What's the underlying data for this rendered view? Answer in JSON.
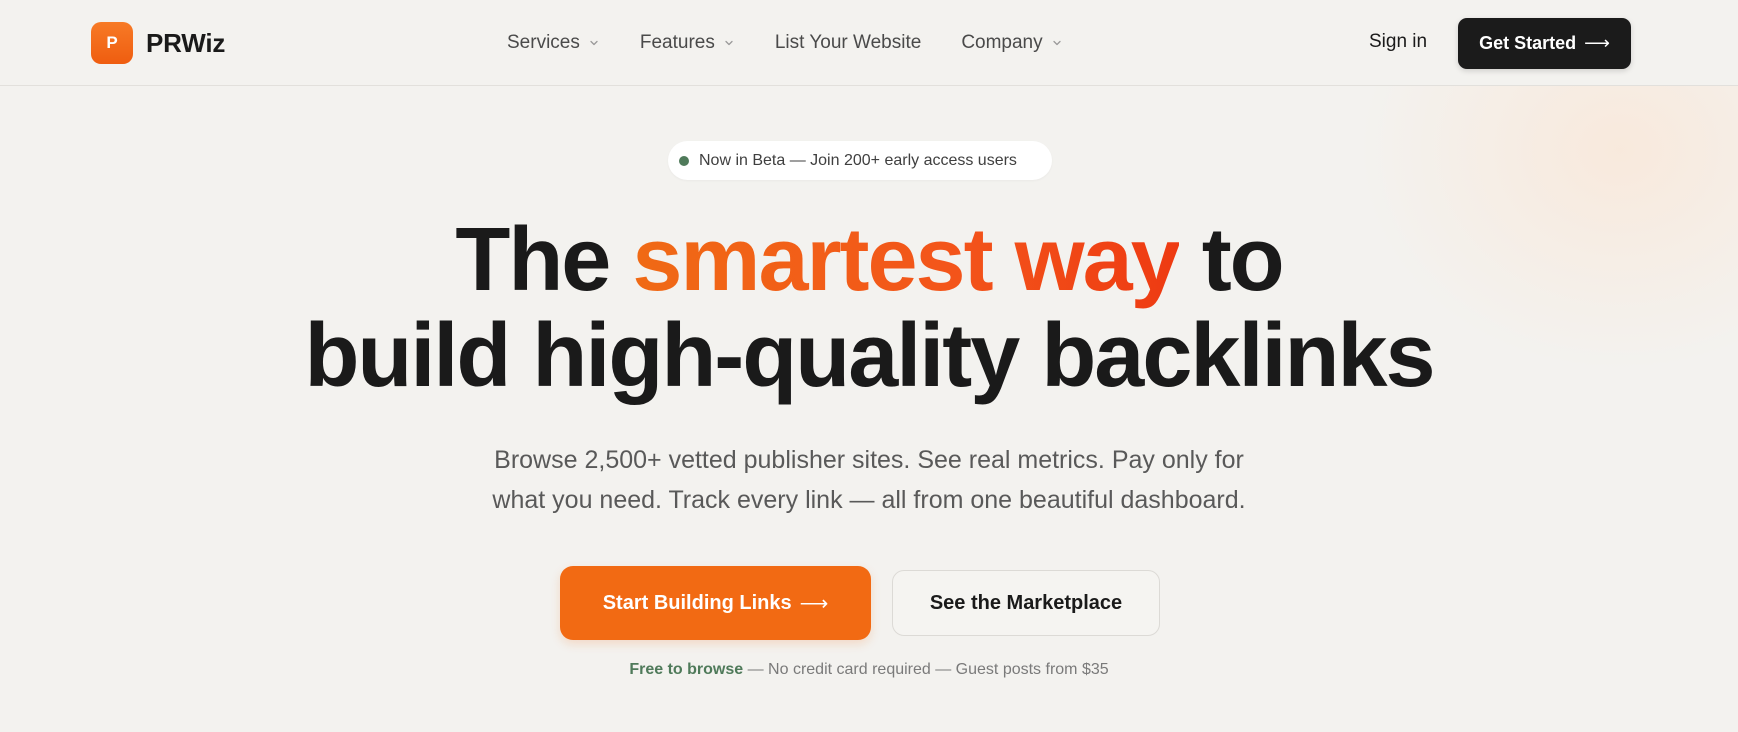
{
  "colors": {
    "brand_orange": "#f26a13",
    "accent_red_orange": "#ee3a12",
    "dark": "#1b1b1b",
    "beta_green": "#4f7a5a",
    "background": "#f3f2ef"
  },
  "header": {
    "logo_letter": "P",
    "logo_text": "PRWiz",
    "nav": [
      {
        "label": "Services",
        "has_dropdown": true,
        "icon": "chevron-down-icon"
      },
      {
        "label": "Features",
        "has_dropdown": true,
        "icon": "chevron-down-icon"
      },
      {
        "label": "List Your Website",
        "has_dropdown": false
      },
      {
        "label": "Company",
        "has_dropdown": true,
        "icon": "chevron-down-icon"
      }
    ],
    "sign_in_label": "Sign in",
    "get_started_label": "Get Started",
    "get_started_icon": "arrow-right-icon",
    "arrow_glyph": "⟶"
  },
  "hero": {
    "beta_badge": "Now in Beta — Join 200+ early access users",
    "headline": {
      "part1": "The ",
      "accent": "smartest way",
      "part2": " to",
      "line2": "build high-quality backlinks"
    },
    "subtitle_line1": "Browse 2,500+ vetted publisher sites. See real metrics. Pay only for",
    "subtitle_line2": "what you need. Track every link — all from one beautiful dashboard.",
    "primary_cta": "Start Building Links",
    "primary_cta_icon": "arrow-right-icon",
    "secondary_cta": "See the Marketplace",
    "footnote_strong": "Free to browse",
    "footnote_rest": " — No credit card required — Guest posts from $35"
  }
}
